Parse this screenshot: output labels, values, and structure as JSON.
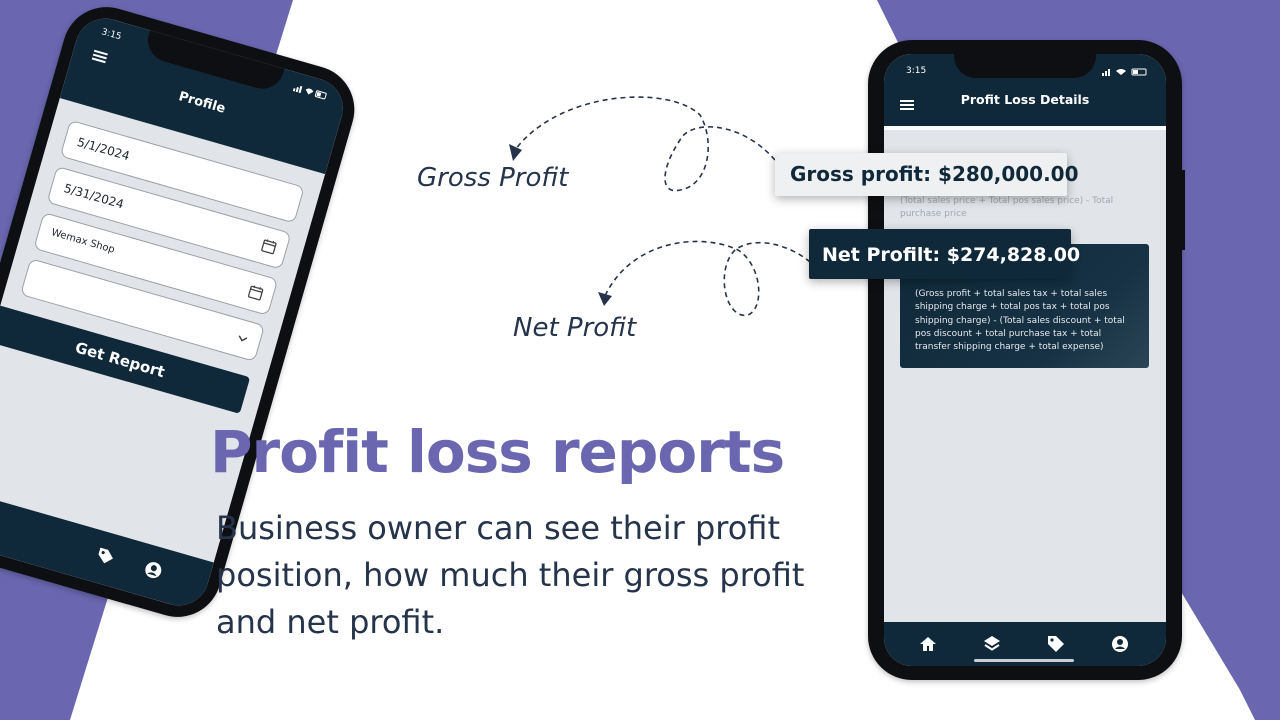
{
  "colors": {
    "accent": "#6a67b0",
    "dark_teal": "#10293a",
    "text_dark": "#26344b"
  },
  "annotations": {
    "gross_profit_label": "Gross Profit",
    "net_profit_label": "Net Profit"
  },
  "hero": {
    "headline": "Profit loss reports",
    "description": "Business owner can see their profit position, how much their gross profit and net profit."
  },
  "left_phone": {
    "status_time": "3:15",
    "title": "Profile",
    "menu_icon": "menu-icon",
    "fields": [
      {
        "value": "5/1/2024",
        "icon": ""
      },
      {
        "value": "5/31/2024",
        "icon": "calendar-icon"
      },
      {
        "value": "Wemax Shop",
        "icon": "calendar-icon"
      }
    ],
    "dropdown_icon": "chevron-down-icon",
    "button_label": "Get Report",
    "nav_icons": [
      "tag-icon",
      "user-icon"
    ]
  },
  "right_phone": {
    "status_time": "3:15",
    "title": "Profit Loss Details",
    "gross_profit": "Gross profit: $280,000.00",
    "gross_profit_formula": "(Total sales price + Total pos sales price) - Total purchase price",
    "net_profit": "Net Profilt: $274,828.00",
    "net_profit_formula": "(Gross profit + total sales tax + total sales shipping charge + total pos tax + total pos shipping charge) - (Total sales discount + total pos discount + total purchase tax + total transfer shipping charge + total expense)",
    "nav_icons": [
      "home-icon",
      "layers-icon",
      "tag-icon",
      "user-icon"
    ]
  }
}
